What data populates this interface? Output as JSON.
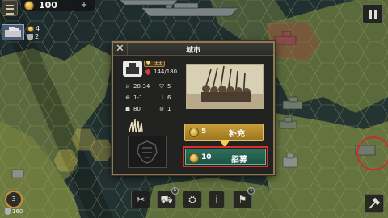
{
  "hud": {
    "gold": "100",
    "city_coin_value": "4",
    "city_shield_value": "2"
  },
  "dialog": {
    "title": "城市",
    "rank": "±±",
    "hp": "144/180",
    "stats": {
      "attack": "28-34",
      "defense": "5",
      "range": "1-1",
      "movement": "6",
      "morale": "80",
      "supply": "1"
    },
    "supply_button": {
      "cost": "5",
      "label": "补充"
    },
    "recruit_button": {
      "cost": "10",
      "label": "招募"
    }
  },
  "toolbar": {
    "level": "3",
    "level_points": "160",
    "badge_a": "6",
    "badge_b": "3"
  },
  "colors": {
    "dialog_border": "#8a7a55",
    "supply_gold": "#c89e38",
    "recruit_teal": "#2f6e5b",
    "highlight_red": "#d8302a"
  }
}
